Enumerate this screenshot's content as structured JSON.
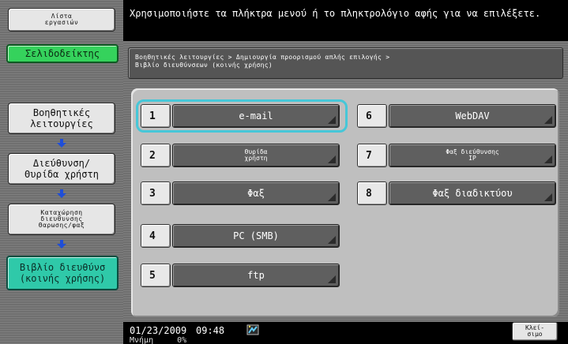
{
  "left": {
    "work_tasks": "Λίστα\nεργασιών",
    "tab_index": "Σελιδοδείκτης",
    "nav_utility": "Βοηθητικές\nλειτουργίες",
    "nav_address_box": "Διεύθυνση/\nΘυρίδα χρήστη",
    "nav_register_fax": "Καταχώρηση\nδιευθυνσης\nΘαρωσης/φαξ",
    "nav_address_book": "Βιβλίο διευθύνσ\n(κοινής χρήσης)"
  },
  "top": {
    "message": "Χρησιμοποιήστε τα πλήκτρα μενού ή το πληκτρολόγιο αφής για να επιλέξετε."
  },
  "path": {
    "line1": "Βοηθητικές λειτουργίες > Δημιουργία προορισμού απλής επιλογής >",
    "line2": "Βιβλίο διευθύνσεων (κοινής χρήσης)"
  },
  "destinations": [
    {
      "num": "1",
      "label": "e-mail",
      "selected": true
    },
    {
      "num": "2",
      "label": "Θυρίδα\nχρήστη",
      "selected": false
    },
    {
      "num": "3",
      "label": "Φαξ",
      "selected": false
    },
    {
      "num": "4",
      "label": "PC (SMB)",
      "selected": false
    },
    {
      "num": "5",
      "label": "ftp",
      "selected": false
    },
    {
      "num": "6",
      "label": "WebDAV",
      "selected": false
    },
    {
      "num": "7",
      "label": "Φαξ διεύθυνσης\nIP",
      "selected": false
    },
    {
      "num": "8",
      "label": "Φαξ διαδικτύου",
      "selected": false
    }
  ],
  "bottom": {
    "date": "01/23/2009",
    "time": "09:48",
    "status_left": "Μνήμη",
    "status_right": "0%",
    "close_label": "Κλεί-\nσιμο",
    "icon": "network-icon"
  },
  "colors": {
    "selected_outline": "#46c7d8",
    "green_tab": "#35d25c",
    "teal_active": "#2fc9a9",
    "arrow_blue": "#1f4ed8"
  }
}
